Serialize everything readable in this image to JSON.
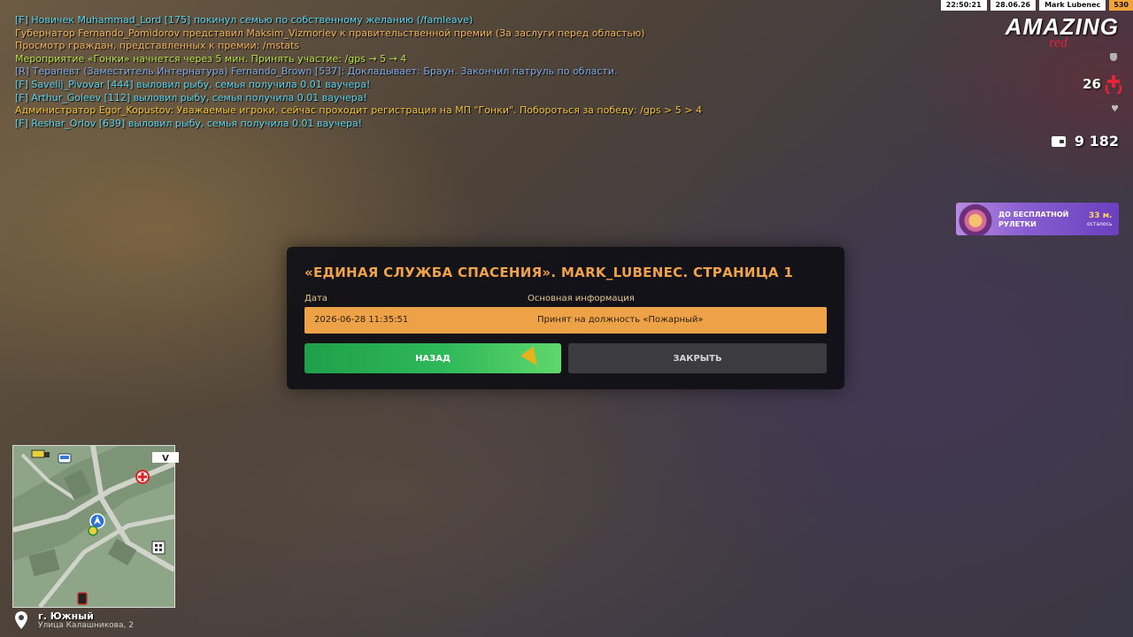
{
  "chat": [
    {
      "text": "[F] Новичек Muhammad_Lord [175] покинул семью по собственному желанию (/famleave)",
      "color": "#59d4f0"
    },
    {
      "text": "Губернатор Fernando_Pomidorov представил Maksim_Vizmoriev к правительственной премии (За заслуги перед областью)",
      "color": "#f2b35a"
    },
    {
      "text": "Просмотр граждан, представленных к премии: /mstats",
      "color": "#f2b35a"
    },
    {
      "text": "Мероприятие «Гонки» начнется через 5 мин. Принять участие: /gps → 5 → 4",
      "color": "#b6e04a"
    },
    {
      "text": "[R] Терапевт (Заместитель Интернатура) Fernando_Brown [537]: Докладывает: Браун. Закончил патруль по области.",
      "color": "#7fa9e6"
    },
    {
      "text": "[F] Savelij_Pivovar [444] выловил рыбу, семья получила 0.01 ваучера!",
      "color": "#59d4f0"
    },
    {
      "text": "[F] Arthur_Goleev [112] выловил рыбу, семья получила 0.01 ваучера!",
      "color": "#59d4f0"
    },
    {
      "text": "Администратор Egor_Kopustov: Уважаемые игроки, сейчас проходит регистрация на МП \"Гонки\". Побороться за победу: /gps > 5 > 4",
      "color": "#f2c23a"
    },
    {
      "text": "[F] Reshar_Orlov [639] выловил рыбу, семья получила 0.01 ваучера!",
      "color": "#59d4f0"
    }
  ],
  "topbar": {
    "time": "22:50:21",
    "date": "28.06.26",
    "player": "Mark Lubenec",
    "id": "530"
  },
  "logo": {
    "main": "AMAZING",
    "sub": "red"
  },
  "hud": {
    "health": "26",
    "money": "9 182",
    "accent": "#e0243a"
  },
  "roulette": {
    "text": "ДО БЕСПЛАТНОЙ РУЛЕТКИ",
    "time": "33 м.",
    "left": "осталось"
  },
  "dialog": {
    "title": "«ЕДИНАЯ СЛУЖБА СПАСЕНИЯ». MARK_LUBENEC. СТРАНИЦА 1",
    "col_date": "Дата",
    "col_info": "Основная информация",
    "row": {
      "date": "2026-06-28 11:35:51",
      "info": "Принят на должность «Пожарный»"
    },
    "back_label": "НАЗАД",
    "close_label": "ЗАКРЫТЬ"
  },
  "map": {
    "city": "г. Южный",
    "street": "Улица Калашникова, 2"
  }
}
